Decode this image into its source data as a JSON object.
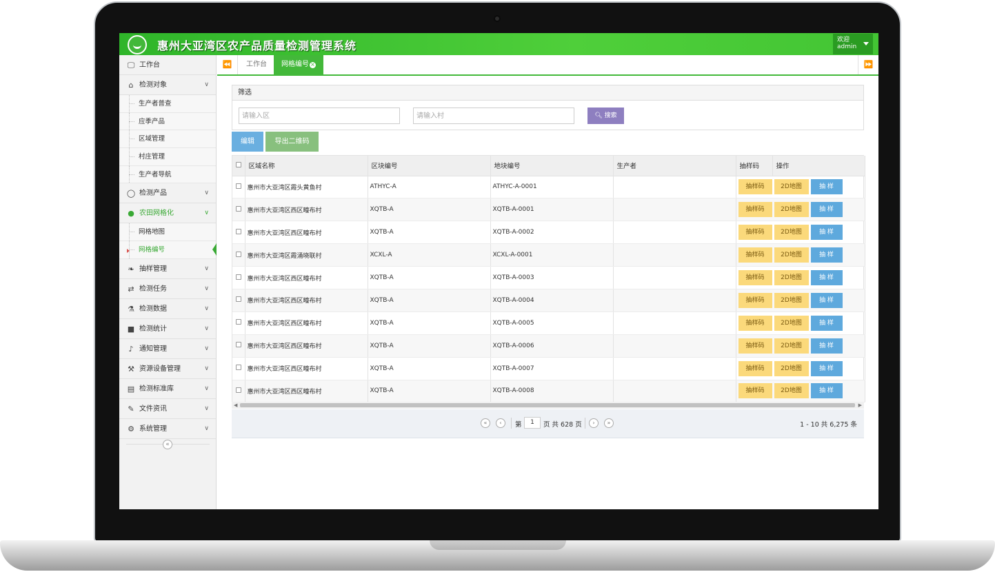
{
  "header": {
    "title": "惠州大亚湾区农产品质量检测管理系统",
    "welcome": "欢迎",
    "user": "admin"
  },
  "sidebar": {
    "items": [
      {
        "label": "工作台",
        "icon": "monitor-icon"
      },
      {
        "label": "检测对象",
        "icon": "home-icon"
      },
      {
        "label": "生产者普查"
      },
      {
        "label": "应季产品"
      },
      {
        "label": "区域管理"
      },
      {
        "label": "村庄管理"
      },
      {
        "label": "生产者导航"
      },
      {
        "label": "检测产品",
        "icon": "leaf-outline-icon"
      },
      {
        "label": "农田网格化",
        "icon": "globe-icon"
      },
      {
        "label": "网格地图"
      },
      {
        "label": "网格编号"
      },
      {
        "label": "抽样管理",
        "icon": "leaf-icon"
      },
      {
        "label": "检测任务",
        "icon": "exchange-icon"
      },
      {
        "label": "检测数据",
        "icon": "flask-icon"
      },
      {
        "label": "检测统计",
        "icon": "folder-icon"
      },
      {
        "label": "通知管理",
        "icon": "volume-icon"
      },
      {
        "label": "资源设备管理",
        "icon": "gavel-icon"
      },
      {
        "label": "检测标准库",
        "icon": "book-icon"
      },
      {
        "label": "文件资讯",
        "icon": "edit-icon"
      },
      {
        "label": "系统管理",
        "icon": "gear-icon"
      }
    ]
  },
  "tabs": [
    {
      "label": "工作台"
    },
    {
      "label": "网格编号"
    }
  ],
  "filter": {
    "title": "筛选",
    "district_placeholder": "请输入区",
    "village_placeholder": "请输入村",
    "search_label": "搜索"
  },
  "toolbar": {
    "edit_label": "编辑",
    "export_label": "导出二维码"
  },
  "table": {
    "columns": [
      "区域名称",
      "区块编号",
      "地块编号",
      "生产者",
      "抽样码",
      "操作"
    ],
    "op_labels": {
      "sample_code": "抽样码",
      "map": "2D地图",
      "pick": "抽 样"
    },
    "rows": [
      {
        "region": "惠州市大亚湾区霞头黄鱼村",
        "block": "ATHYC-A",
        "plot": "ATHYC-A-0001",
        "producer": ""
      },
      {
        "region": "惠州市大亚湾区西区疃布村",
        "block": "XQTB-A",
        "plot": "XQTB-A-0001",
        "producer": ""
      },
      {
        "region": "惠州市大亚湾区西区疃布村",
        "block": "XQTB-A",
        "plot": "XQTB-A-0002",
        "producer": ""
      },
      {
        "region": "惠州市大亚湾区霞涌晓联村",
        "block": "XCXL-A",
        "plot": "XCXL-A-0001",
        "producer": ""
      },
      {
        "region": "惠州市大亚湾区西区疃布村",
        "block": "XQTB-A",
        "plot": "XQTB-A-0003",
        "producer": ""
      },
      {
        "region": "惠州市大亚湾区西区疃布村",
        "block": "XQTB-A",
        "plot": "XQTB-A-0004",
        "producer": ""
      },
      {
        "region": "惠州市大亚湾区西区疃布村",
        "block": "XQTB-A",
        "plot": "XQTB-A-0005",
        "producer": ""
      },
      {
        "region": "惠州市大亚湾区西区疃布村",
        "block": "XQTB-A",
        "plot": "XQTB-A-0006",
        "producer": ""
      },
      {
        "region": "惠州市大亚湾区西区疃布村",
        "block": "XQTB-A",
        "plot": "XQTB-A-0007",
        "producer": ""
      },
      {
        "region": "惠州市大亚湾区西区疃布村",
        "block": "XQTB-A",
        "plot": "XQTB-A-0008",
        "producer": ""
      }
    ]
  },
  "pagination": {
    "page_prefix": "第",
    "current_page": "1",
    "page_suffix": "页 共 628 页",
    "info": "1 - 10 共 6,275 条"
  },
  "colors": {
    "brand_green": "#43b83a",
    "search_purple": "#8e7fc0",
    "edit_blue": "#6aafe0",
    "export_green": "#88c07e",
    "sample_yellow": "#fbd97b",
    "pick_blue": "#5ea9dd"
  }
}
